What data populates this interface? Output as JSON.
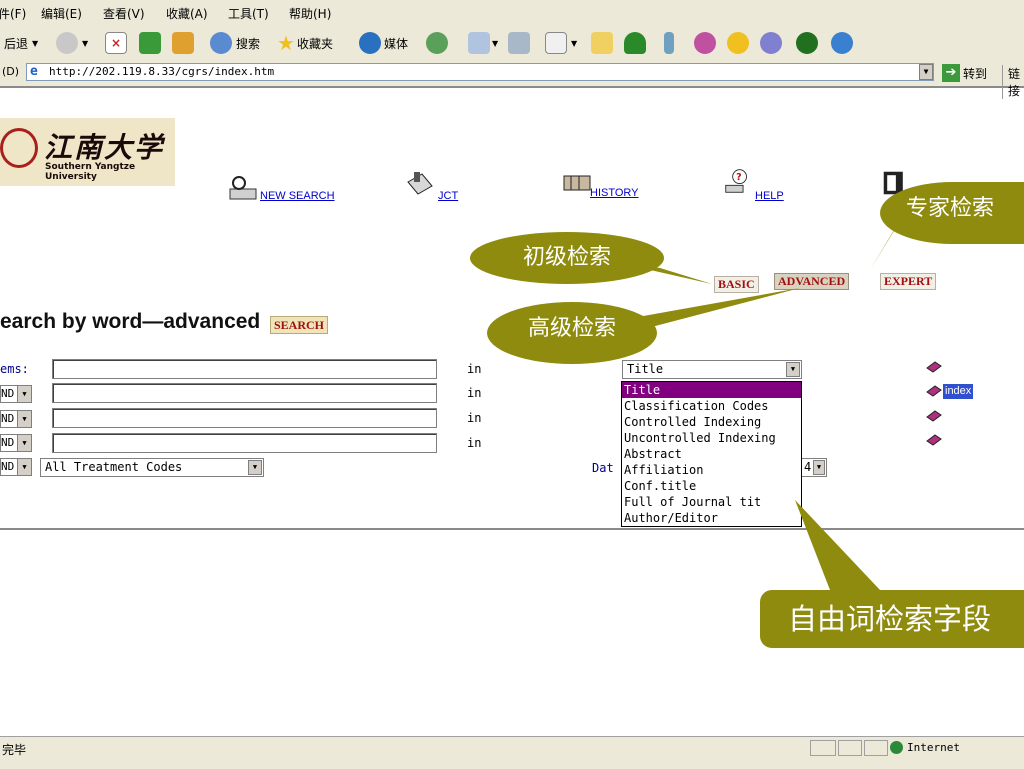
{
  "menu": [
    "件(F)",
    "编辑(E)",
    "查看(V)",
    "收藏(A)",
    "工具(T)",
    "帮助(H)"
  ],
  "toolbar": {
    "back": "后退",
    "search": "搜索",
    "favorites": "收藏夹",
    "media": "媒体"
  },
  "address": {
    "label": "(D)",
    "url": "http://202.119.8.33/cgrs/index.htm",
    "go": "转到",
    "links": "链接"
  },
  "logo": {
    "cn": "江南大学",
    "en": "Southern Yangtze University"
  },
  "nav": {
    "new_search": "NEW SEARCH",
    "jct": "JCT",
    "history": "HISTORY",
    "help": "HELP"
  },
  "modes": {
    "basic": "BASIC",
    "advanced": "ADVANCED",
    "expert": "EXPERT"
  },
  "heading": "earch by word—advanced",
  "search_button": "SEARCH",
  "form": {
    "terms_label": "ems:",
    "op": "ND",
    "in": "in",
    "field_selected": "Title",
    "field_options": [
      "Title",
      "Classification Codes",
      "Controlled Indexing",
      "Uncontrolled Indexing",
      "Abstract",
      "Affiliation",
      "Conf.title",
      "Full of Journal tit",
      "Author/Editor"
    ],
    "index": "index",
    "treatment": "All Treatment Codes",
    "date_label": "Dat",
    "year": "4"
  },
  "callouts": {
    "basic": "初级检索",
    "advanced": "高级检索",
    "expert": "专家检索",
    "fields": "自由词检索字段"
  },
  "status": {
    "text": "完毕",
    "zone": "Internet"
  },
  "colors": {
    "callout": "#8f8b0e",
    "link": "#0000cc",
    "mode_text": "#a01010",
    "selected_option": "#800080"
  }
}
